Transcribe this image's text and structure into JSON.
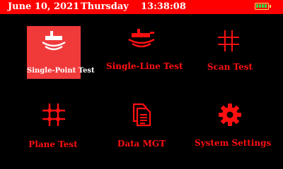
{
  "status_bar": {
    "date": "June 10, 2021",
    "day": "Thursday",
    "time": "13:38:08",
    "battery_icon": "battery-full-icon",
    "battery_level": 1.0
  },
  "menu": {
    "selected_index": 0,
    "items": [
      {
        "label": "Single-Point Test",
        "icon": "single-point-test-icon"
      },
      {
        "label": "Single-Line Test",
        "icon": "single-line-test-icon"
      },
      {
        "label": "Scan Test",
        "icon": "scan-grid-icon"
      },
      {
        "label": "Plane Test",
        "icon": "plane-grid-icon"
      },
      {
        "label": "Data MGT",
        "icon": "documents-icon"
      },
      {
        "label": "System Settings",
        "icon": "gear-icon"
      }
    ]
  },
  "colors": {
    "accent": "#ff0000",
    "selected_tile": "#f03a3a",
    "background": "#000000",
    "battery_outline": "#f2e36a",
    "battery_fill": "#2fe04a"
  }
}
